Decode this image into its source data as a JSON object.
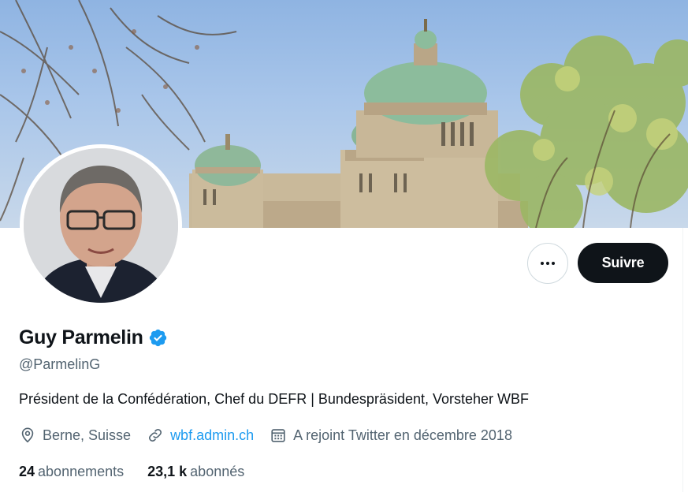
{
  "profile": {
    "name": "Guy Parmelin",
    "handle": "@ParmelinG",
    "bio": "Président de la Confédération, Chef du DEFR | Bundespräsident, Vorsteher WBF",
    "location": "Berne, Suisse",
    "website": "wbf.admin.ch",
    "joined": "A rejoint Twitter en décembre 2018",
    "verified": true
  },
  "actions": {
    "follow_label": "Suivre"
  },
  "stats": {
    "following_count": "24",
    "following_label": "abonnements",
    "followers_count": "23,1 k",
    "followers_label": "abonnés"
  },
  "icons": {
    "verified": "verified-badge-icon",
    "location": "location-pin-icon",
    "link": "link-icon",
    "calendar": "calendar-icon",
    "more": "more-dots-icon"
  },
  "colors": {
    "accent": "#1d9bf0",
    "follow_button": "#0f1419",
    "secondary_text": "#536471"
  }
}
